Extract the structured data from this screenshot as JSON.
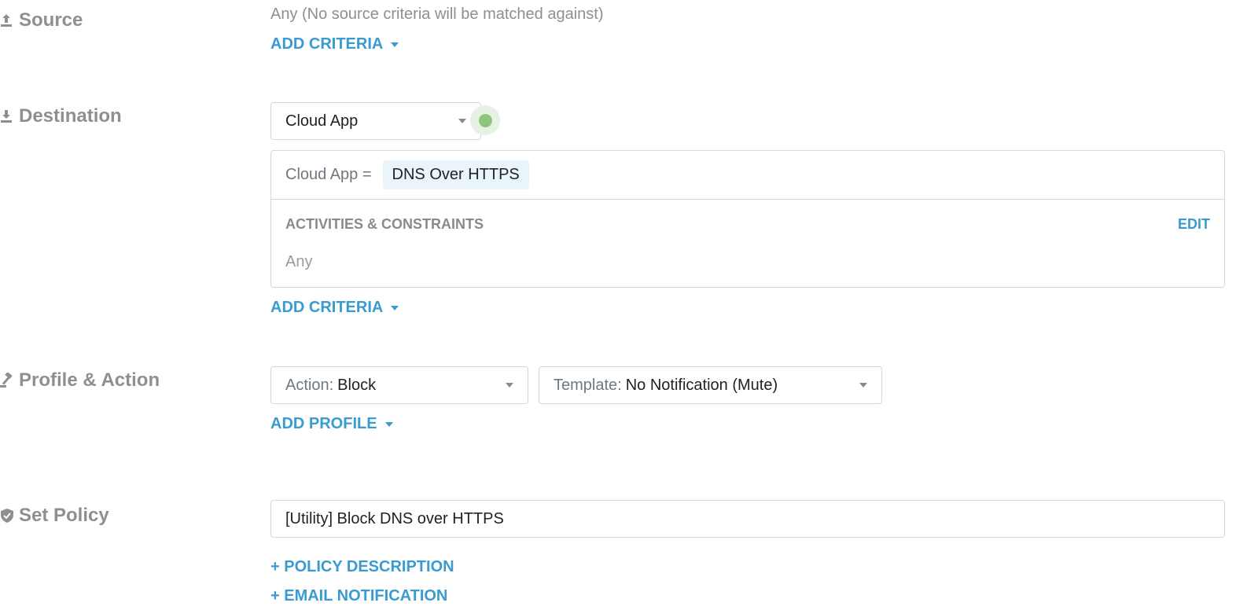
{
  "source": {
    "label": "Source",
    "icon": "upload-icon",
    "description": "Any (No source criteria will be matched against)",
    "add_criteria_label": "ADD CRITERIA"
  },
  "destination": {
    "label": "Destination",
    "icon": "download-icon",
    "type_select": {
      "value": "Cloud App"
    },
    "status_color": "#8fc77a",
    "criteria": {
      "key": "Cloud App =",
      "value": "DNS Over HTTPS"
    },
    "activities": {
      "title": "ACTIVITIES & CONSTRAINTS",
      "edit_label": "EDIT",
      "value": "Any"
    },
    "add_criteria_label": "ADD CRITERIA"
  },
  "profile_action": {
    "label": "Profile & Action",
    "icon": "gavel-icon",
    "action_select": {
      "prefix": "Action:",
      "value": "Block"
    },
    "template_select": {
      "prefix": "Template:",
      "value": "No Notification (Mute)"
    },
    "add_profile_label": "ADD PROFILE"
  },
  "set_policy": {
    "label": "Set Policy",
    "icon": "shield-check-icon",
    "policy_name_value": "[Utility] Block DNS over HTTPS",
    "policy_description_label": "+ POLICY DESCRIPTION",
    "email_notification_label": "+ EMAIL NOTIFICATION"
  },
  "colors": {
    "accent": "#3a9bd1",
    "label_gray": "#8f8f8f",
    "chip_bg": "#eaf4fb"
  }
}
